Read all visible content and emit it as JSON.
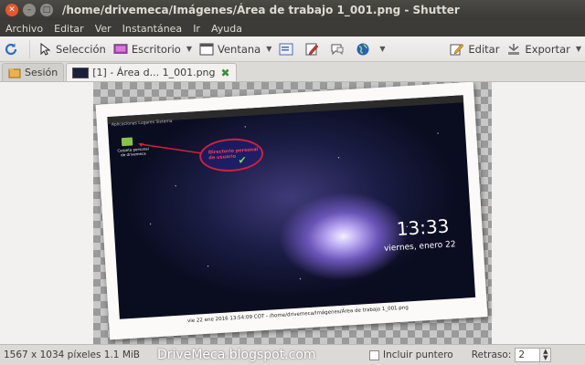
{
  "window": {
    "title": "/home/drivemeca/Imágenes/Área de trabajo 1_001.png - Shutter"
  },
  "menu": [
    "Archivo",
    "Editar",
    "Ver",
    "Instantánea",
    "Ir",
    "Ayuda"
  ],
  "toolbar": {
    "seleccion": "Selección",
    "escritorio": "Escritorio",
    "ventana": "Ventana",
    "editar": "Editar",
    "exportar": "Exportar"
  },
  "tabs": {
    "session": "Sesión",
    "file": "[1] - Área d... 1_001.png"
  },
  "preview": {
    "clock": "13:33",
    "date": "viernes, enero 22",
    "annotation": "Directorio personal de usuario",
    "folder_label": "Carpeta personal de drivemeca",
    "caption": "vie 22 ene 2016 13:54:09 COT - /home/drivemeca/Imágenes/Área de trabajo 1_001.png",
    "panel": "Aplicaciones  Lugares  Sistema"
  },
  "status": {
    "info": "1567 x 1034 píxeles  1.1 MiB",
    "watermark": "DriveMeca.blogspot.com",
    "pointer_label": "Incluir puntero",
    "delay_label": "Retraso:",
    "delay_value": "2"
  }
}
